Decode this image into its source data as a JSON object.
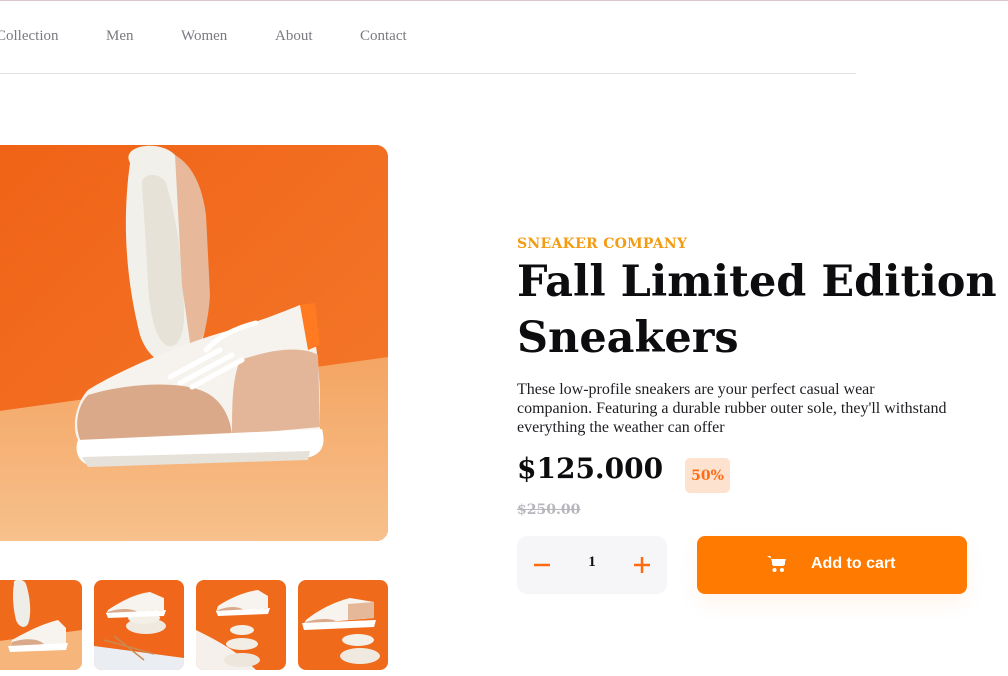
{
  "nav": {
    "items": [
      "Collection",
      "Men",
      "Women",
      "About",
      "Contact"
    ]
  },
  "gallery": {
    "main_image": "white-and-tan-sneakers-on-orange-background",
    "thumbnails": [
      "sneakers-thumbnail-1",
      "sneakers-thumbnail-2",
      "sneakers-thumbnail-3",
      "sneakers-thumbnail-4"
    ]
  },
  "product": {
    "brand": "SNEAKER COMPANY",
    "title": "Fall Limited Edition Sneakers",
    "description": "These low-profile sneakers are your perfect casual wear companion. Featuring a durable rubber outer sole, they'll withstand everything the weather can offer",
    "price": "$125.000",
    "discount": "50%",
    "old_price": "$250.00"
  },
  "cart": {
    "quantity": "1",
    "minus_icon": "minus-icon",
    "plus_icon": "plus-icon",
    "add_label": "Add to cart",
    "icon": "cart-icon"
  },
  "colors": {
    "accent": "#ff7a00",
    "brand_text": "#f39c12",
    "badge_bg": "#fde2d0"
  }
}
